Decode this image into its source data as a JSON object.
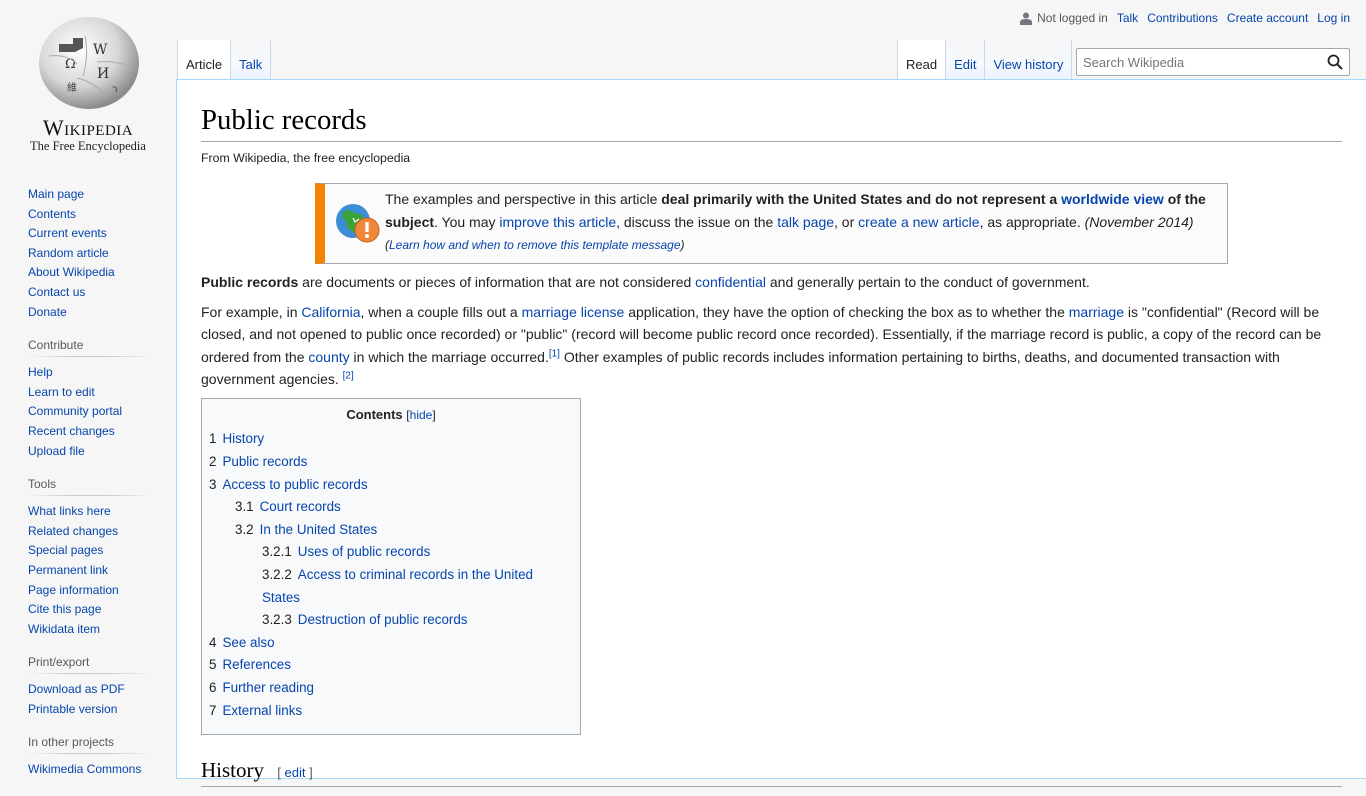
{
  "logo": {
    "wordmark": "Wikipedia",
    "tagline": "The Free Encyclopedia"
  },
  "personal_tools": {
    "status": "Not logged in",
    "links": [
      "Talk",
      "Contributions",
      "Create account",
      "Log in"
    ]
  },
  "namespace_tabs": [
    {
      "label": "Article",
      "selected": true
    },
    {
      "label": "Talk",
      "selected": false
    }
  ],
  "view_tabs": [
    {
      "label": "Read",
      "selected": true
    },
    {
      "label": "Edit",
      "selected": false
    },
    {
      "label": "View history",
      "selected": false
    }
  ],
  "search": {
    "placeholder": "Search Wikipedia",
    "value": ""
  },
  "sidebar": {
    "navigation": [
      "Main page",
      "Contents",
      "Current events",
      "Random article",
      "About Wikipedia",
      "Contact us",
      "Donate"
    ],
    "contribute": {
      "heading": "Contribute",
      "items": [
        "Help",
        "Learn to edit",
        "Community portal",
        "Recent changes",
        "Upload file"
      ]
    },
    "tools": {
      "heading": "Tools",
      "items": [
        "What links here",
        "Related changes",
        "Special pages",
        "Permanent link",
        "Page information",
        "Cite this page",
        "Wikidata item"
      ]
    },
    "print": {
      "heading": "Print/export",
      "items": [
        "Download as PDF",
        "Printable version"
      ]
    },
    "other_projects": {
      "heading": "In other projects",
      "items": [
        "Wikimedia Commons"
      ]
    }
  },
  "article": {
    "title": "Public records",
    "site_sub": "From Wikipedia, the free encyclopedia",
    "ambox": {
      "t1": "The examples and perspective in this article ",
      "b1": "deal primarily with the United States and do not represent a ",
      "l1": "worldwide view",
      "b2": " of the subject",
      "t2": ". You may ",
      "l2": "improve this article",
      "t3": ", discuss the issue on the ",
      "l3": "talk page",
      "t4": ", or ",
      "l4": "create a new article",
      "t5": ", as appropriate. ",
      "date": "(November 2014)",
      "small_open": "(",
      "small_link": "Learn how and when to remove this template message",
      "small_close": ")"
    },
    "p1": {
      "bold": "Public records",
      "t1": " are documents or pieces of information that are not considered ",
      "l1": "confidential",
      "t2": " and generally pertain to the conduct of government."
    },
    "p2": {
      "t1": "For example, in ",
      "l1": "California",
      "t2": ", when a couple fills out a ",
      "l2": "marriage license",
      "t3": " application, they have the option of checking the box as to whether the ",
      "l3": "marriage",
      "t4": " is \"confidential\" (Record will be closed, and not opened to public once recorded) or \"public\" (record will become public record once recorded). Essentially, if the marriage record is public, a copy of the record can be ordered from the ",
      "l4": "county",
      "t5": " in which the marriage occurred.",
      "ref1": "[1]",
      "t6": " Other examples of public records includes information pertaining to births, deaths, and documented transaction with government agencies. ",
      "ref2": "[2]"
    },
    "toc": {
      "title": "Contents",
      "toggle": "hide",
      "items": [
        {
          "num": "1",
          "label": "History",
          "level": 1
        },
        {
          "num": "2",
          "label": "Public records",
          "level": 1
        },
        {
          "num": "3",
          "label": "Access to public records",
          "level": 1
        },
        {
          "num": "3.1",
          "label": "Court records",
          "level": 2
        },
        {
          "num": "3.2",
          "label": "In the United States",
          "level": 2
        },
        {
          "num": "3.2.1",
          "label": "Uses of public records",
          "level": 3
        },
        {
          "num": "3.2.2",
          "label": "Access to criminal records in the United States",
          "level": 3
        },
        {
          "num": "3.2.3",
          "label": "Destruction of public records",
          "level": 3
        },
        {
          "num": "4",
          "label": "See also",
          "level": 1
        },
        {
          "num": "5",
          "label": "References",
          "level": 1
        },
        {
          "num": "6",
          "label": "Further reading",
          "level": 1
        },
        {
          "num": "7",
          "label": "External links",
          "level": 1
        }
      ]
    },
    "section_history": {
      "title": "History",
      "edit": "edit"
    }
  }
}
